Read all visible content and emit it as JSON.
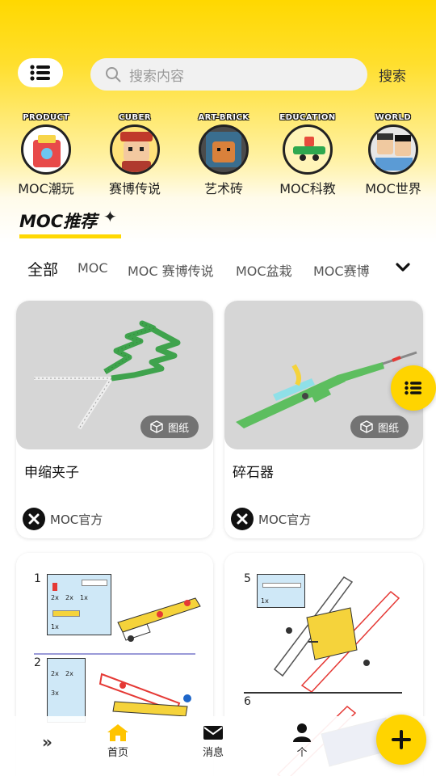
{
  "search": {
    "placeholder": "搜索内容",
    "button_label": "搜索"
  },
  "categories": [
    {
      "label": "MOC潮玩",
      "badge": "PRODUCT"
    },
    {
      "label": "赛博传说",
      "badge": "CUBER"
    },
    {
      "label": "艺术砖",
      "badge": "ART-BRICK"
    },
    {
      "label": "MOC科教",
      "badge": "EDUCATION"
    },
    {
      "label": "MOC世界",
      "badge": "WORLD"
    }
  ],
  "section": {
    "title": "MOC推荐"
  },
  "tabs": [
    "全部",
    "MOC",
    "MOC 赛博传说",
    "MOC盆栽",
    "MOC赛博"
  ],
  "cards": [
    {
      "title": "申缩夹子",
      "badge": "图纸",
      "author": "MOC官方"
    },
    {
      "title": "碎石器",
      "badge": "图纸",
      "author": "MOC官方"
    }
  ],
  "step_cards": [
    {
      "steps": [
        "1",
        "2"
      ],
      "qty": [
        "2x",
        "2x",
        "1x",
        "1x",
        "2x",
        "2x",
        "3x"
      ]
    },
    {
      "steps": [
        "5",
        "6"
      ],
      "qty": [
        "1x"
      ]
    }
  ],
  "bottom_nav": {
    "home": "首页",
    "messages": "消息",
    "profile": "个"
  },
  "colors": {
    "brand": "#FFD800",
    "accent": "#FFD400"
  }
}
